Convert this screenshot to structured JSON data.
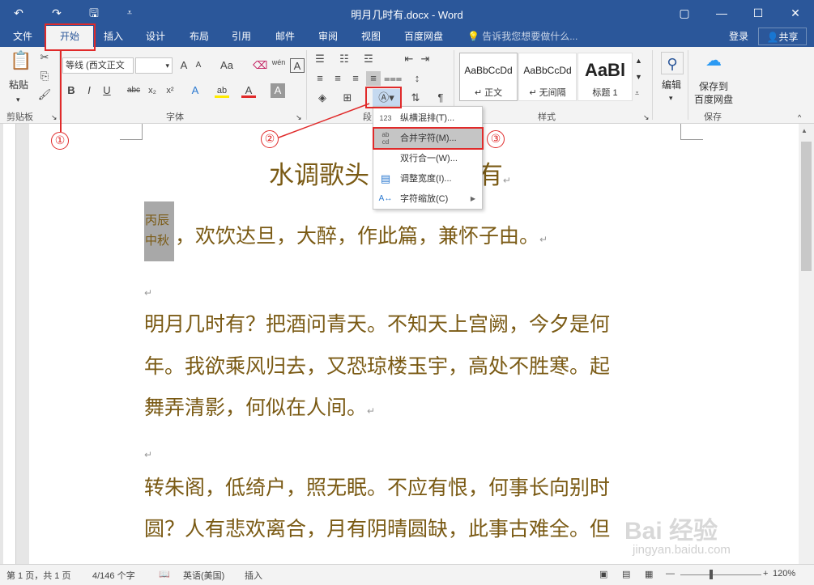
{
  "titlebar": {
    "title": "明月几时有.docx - Word",
    "undo": "↶",
    "redo": "↷",
    "save": "🖫",
    "customize": "⩡",
    "ribbon_display": "▢",
    "minimize": "—",
    "maximize": "☐",
    "close": "✕"
  },
  "tabs": [
    "文件",
    "开始",
    "插入",
    "设计",
    "布局",
    "引用",
    "邮件",
    "审阅",
    "视图",
    "百度网盘"
  ],
  "tellme": "告诉我您想要做什么...",
  "login": "登录",
  "share": "共享",
  "ribbon": {
    "clipboard": {
      "paste": "粘贴",
      "label": "剪贴板"
    },
    "font": {
      "name": "等线 (西文正文",
      "size": "",
      "grow": "A",
      "shrink": "A",
      "case": "Aa",
      "pinyin": "wén",
      "border_char": "A",
      "bold": "B",
      "italic": "I",
      "underline": "U",
      "strike": "abc",
      "sub": "x₂",
      "sup": "x²",
      "effects": "A",
      "highlight": "ab",
      "color": "A",
      "shade": "A",
      "label": "字体"
    },
    "paragraph": {
      "label": "段"
    },
    "styles": {
      "items": [
        {
          "sample": "AaBbCcDd",
          "name": "↵ 正文"
        },
        {
          "sample": "AaBbCcDd",
          "name": "↵ 无间隔"
        },
        {
          "sample": "AaBl",
          "name": "标题 1"
        }
      ],
      "label": "样式"
    },
    "editing": {
      "label": "编辑"
    },
    "save_group": {
      "btn": "保存到\n百度网盘",
      "line1": "保存到",
      "line2": "百度网盘",
      "label": "保存"
    }
  },
  "annotations": {
    "one": "①",
    "two": "②",
    "three": "③"
  },
  "menu": [
    {
      "icon": "123",
      "label": "纵横混排(T)..."
    },
    {
      "icon": "ab cd",
      "label": "合并字符(M)..."
    },
    {
      "icon": "",
      "label": "双行合一(W)..."
    },
    {
      "icon": "▤",
      "label": "调整宽度(I)..."
    },
    {
      "icon": "A↔",
      "label": "字符缩放(C)"
    }
  ],
  "document": {
    "title": "水调歌头 明月几时有",
    "combined_char": [
      "丙辰",
      "中秋"
    ],
    "line1": "，欢饮达旦，大醉，作此篇，兼怀子由。",
    "para1": [
      "明月几时有？把酒问青天。不知天上宫阙，今夕是何",
      "年。我欲乘风归去，又恐琼楼玉宇，高处不胜寒。起",
      "舞弄清影，何似在人间。"
    ],
    "para2": [
      "转朱阁，低绮户，照无眠。不应有恨，何事长向别时",
      "圆？人有悲欢离合，月有阴晴圆缺，此事古难全。但"
    ],
    "para_mark": "↵"
  },
  "status": {
    "page": "第 1 页，共 1 页",
    "words": "4/146 个字",
    "lang": "英语(美国)",
    "mode": "插入",
    "zoom": "120%"
  },
  "watermark": {
    "text": "Bai 经验",
    "url": "jingyan.baidu.com"
  }
}
